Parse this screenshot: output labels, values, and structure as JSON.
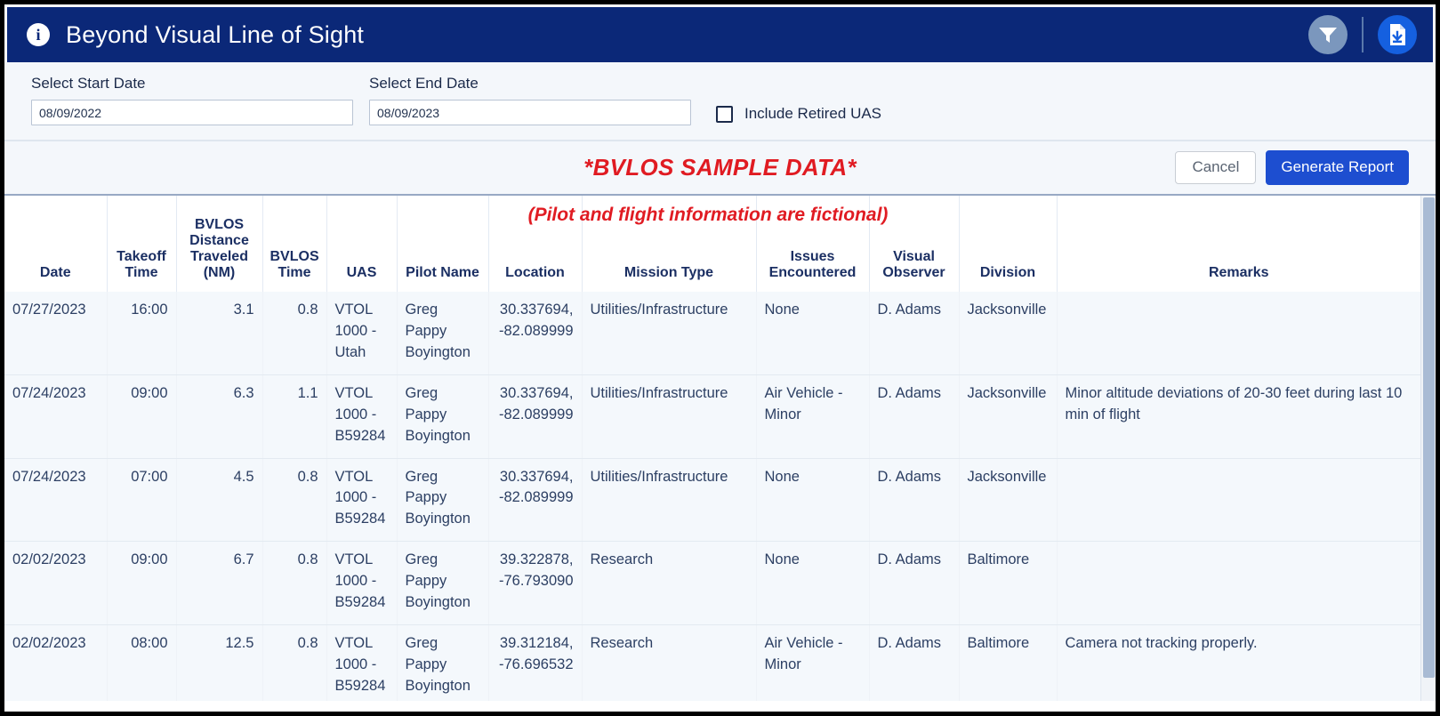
{
  "window": {
    "title": "Beyond Visual Line of Sight",
    "info_icon": "info-icon"
  },
  "titlebar_actions": {
    "filter_icon": "filter-icon",
    "download_icon": "download-file-icon"
  },
  "filters": {
    "start_date_label": "Select Start Date",
    "start_date_value": "08/09/2022",
    "start_date_placeholder": "mm/dd/yyyy",
    "end_date_label": "Select End Date",
    "end_date_value": "08/09/2023",
    "end_date_placeholder": "mm/dd/yyyy",
    "include_retired_label": "Include Retired UAS",
    "include_retired_checked": false
  },
  "banners": {
    "sample_data": "*BVLOS SAMPLE DATA*",
    "fictional_note": "(Pilot and flight information are fictional)"
  },
  "actions": {
    "cancel_label": "Cancel",
    "generate_label": "Generate Report"
  },
  "colors": {
    "titlebar": "#0b2878",
    "primary_button": "#1d4ed8",
    "alert_red": "#e01b22",
    "header_text": "#1b2f63",
    "row_background": "#f4f8fc"
  },
  "table": {
    "columns": [
      "Date",
      "Takeoff Time",
      "BVLOS Distance Traveled (NM)",
      "BVLOS Time",
      "UAS",
      "Pilot Name",
      "Location",
      "Mission Type",
      "Issues Encountered",
      "Visual Observer",
      "Division",
      "Remarks"
    ],
    "rows": [
      {
        "date": "07/27/2023",
        "takeoff_time": "16:00",
        "bvlos_distance_nm": "3.1",
        "bvlos_time": "0.8",
        "uas": "VTOL 1000 - Utah",
        "pilot_name": "Greg Pappy Boyington",
        "location": "30.337694, -82.089999",
        "mission_type": "Utilities/Infrastructure",
        "issues_encountered": "None",
        "visual_observer": "D. Adams",
        "division": "Jacksonville",
        "remarks": ""
      },
      {
        "date": "07/24/2023",
        "takeoff_time": "09:00",
        "bvlos_distance_nm": "6.3",
        "bvlos_time": "1.1",
        "uas": "VTOL 1000 - B59284",
        "pilot_name": "Greg Pappy Boyington",
        "location": "30.337694, -82.089999",
        "mission_type": "Utilities/Infrastructure",
        "issues_encountered": "Air Vehicle - Minor",
        "visual_observer": "D. Adams",
        "division": "Jacksonville",
        "remarks": "Minor altitude deviations of 20-30 feet during last 10 min of flight"
      },
      {
        "date": "07/24/2023",
        "takeoff_time": "07:00",
        "bvlos_distance_nm": "4.5",
        "bvlos_time": "0.8",
        "uas": "VTOL 1000 - B59284",
        "pilot_name": "Greg Pappy Boyington",
        "location": "30.337694, -82.089999",
        "mission_type": "Utilities/Infrastructure",
        "issues_encountered": "None",
        "visual_observer": "D. Adams",
        "division": "Jacksonville",
        "remarks": ""
      },
      {
        "date": "02/02/2023",
        "takeoff_time": "09:00",
        "bvlos_distance_nm": "6.7",
        "bvlos_time": "0.8",
        "uas": "VTOL 1000 - B59284",
        "pilot_name": "Greg Pappy Boyington",
        "location": "39.322878, -76.793090",
        "mission_type": "Research",
        "issues_encountered": "None",
        "visual_observer": "D. Adams",
        "division": "Baltimore",
        "remarks": ""
      },
      {
        "date": "02/02/2023",
        "takeoff_time": "08:00",
        "bvlos_distance_nm": "12.5",
        "bvlos_time": "0.8",
        "uas": "VTOL 1000 - B59284",
        "pilot_name": "Greg Pappy Boyington",
        "location": "39.312184, -76.696532",
        "mission_type": "Research",
        "issues_encountered": "Air Vehicle - Minor",
        "visual_observer": "D. Adams",
        "division": "Baltimore",
        "remarks": "Camera not tracking properly."
      }
    ]
  }
}
